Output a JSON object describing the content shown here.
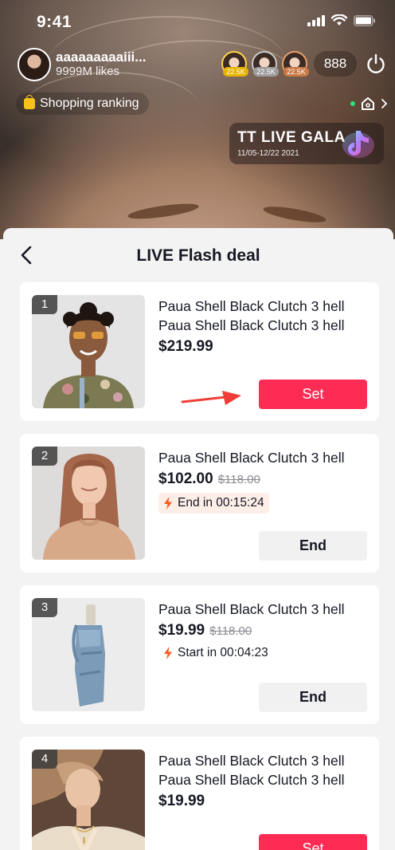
{
  "status_bar": {
    "time": "9:41"
  },
  "host": {
    "name": "aaaaaaaaaiii...",
    "likes": "9999M likes"
  },
  "top_viewers": [
    {
      "count": "22.5K"
    },
    {
      "count": "22.5K"
    },
    {
      "count": "22.5K"
    }
  ],
  "viewer_count": "888",
  "shopping_ranking": {
    "label": "Shopping ranking"
  },
  "gala": {
    "title": "TT LIVE GALA",
    "date": "11/05-12/22 2021"
  },
  "sheet": {
    "title": "LIVE Flash deal"
  },
  "deals": [
    {
      "rank": "1",
      "title": "Paua Shell Black Clutch 3 hell Paua Shell Black Clutch 3 hell",
      "price": "$219.99",
      "action": "Set"
    },
    {
      "rank": "2",
      "title": "Paua Shell Black Clutch 3 hell",
      "price": "$102.00",
      "original_price": "$118.00",
      "timer": "End in 00:15:24",
      "action": "End"
    },
    {
      "rank": "3",
      "title": "Paua Shell Black Clutch 3 hell",
      "price": "$19.99",
      "original_price": "$118.00",
      "timer": "Start in 00:04:23",
      "action": "End"
    },
    {
      "rank": "4",
      "title": "Paua Shell Black Clutch 3 hell Paua Shell Black Clutch 3 hell",
      "price": "$19.99",
      "action": "Set"
    }
  ],
  "colors": {
    "primary": "#fe2c55",
    "text": "#161823",
    "muted": "#8a8b91",
    "timer_bg": "#fdeee8",
    "bolt": "#fe5a1f"
  }
}
